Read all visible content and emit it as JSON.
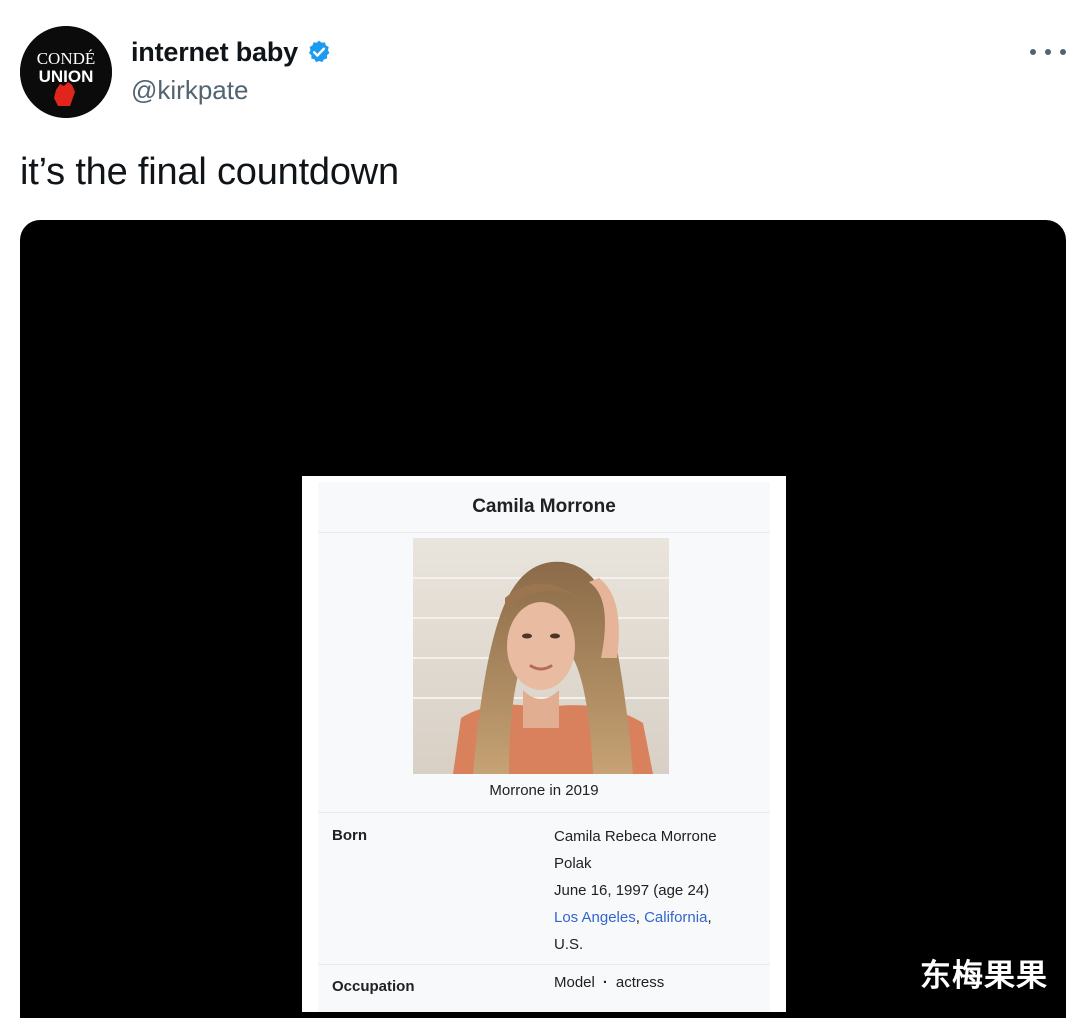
{
  "tweet": {
    "avatar_logo_text": [
      "CONDÉ",
      "UNION"
    ],
    "display_name": "internet baby",
    "handle": "@kirkpate",
    "text": "it’s the final countdown",
    "more_icon": "more-horizontal-icon",
    "verified_icon": "verified-badge-icon",
    "verified_color": "#1d9bf0"
  },
  "media": {
    "background": "#000000",
    "infobox": {
      "title": "Camila Morrone",
      "caption": "Morrone in 2019",
      "born_label": "Born",
      "born_name": "Camila Rebeca Morrone Polak",
      "born_date": "June 16, 1997 (age 24)",
      "born_place_city": "Los Angeles",
      "born_place_sep": ", ",
      "born_place_state": "California",
      "born_place_end": ",",
      "born_country": "U.S.",
      "occupation_label": "Occupation",
      "occupation_1": "Model",
      "occupation_sep": "·",
      "occupation_2": "actress",
      "link_color": "#3366cc"
    }
  },
  "watermark": "东梅果果"
}
